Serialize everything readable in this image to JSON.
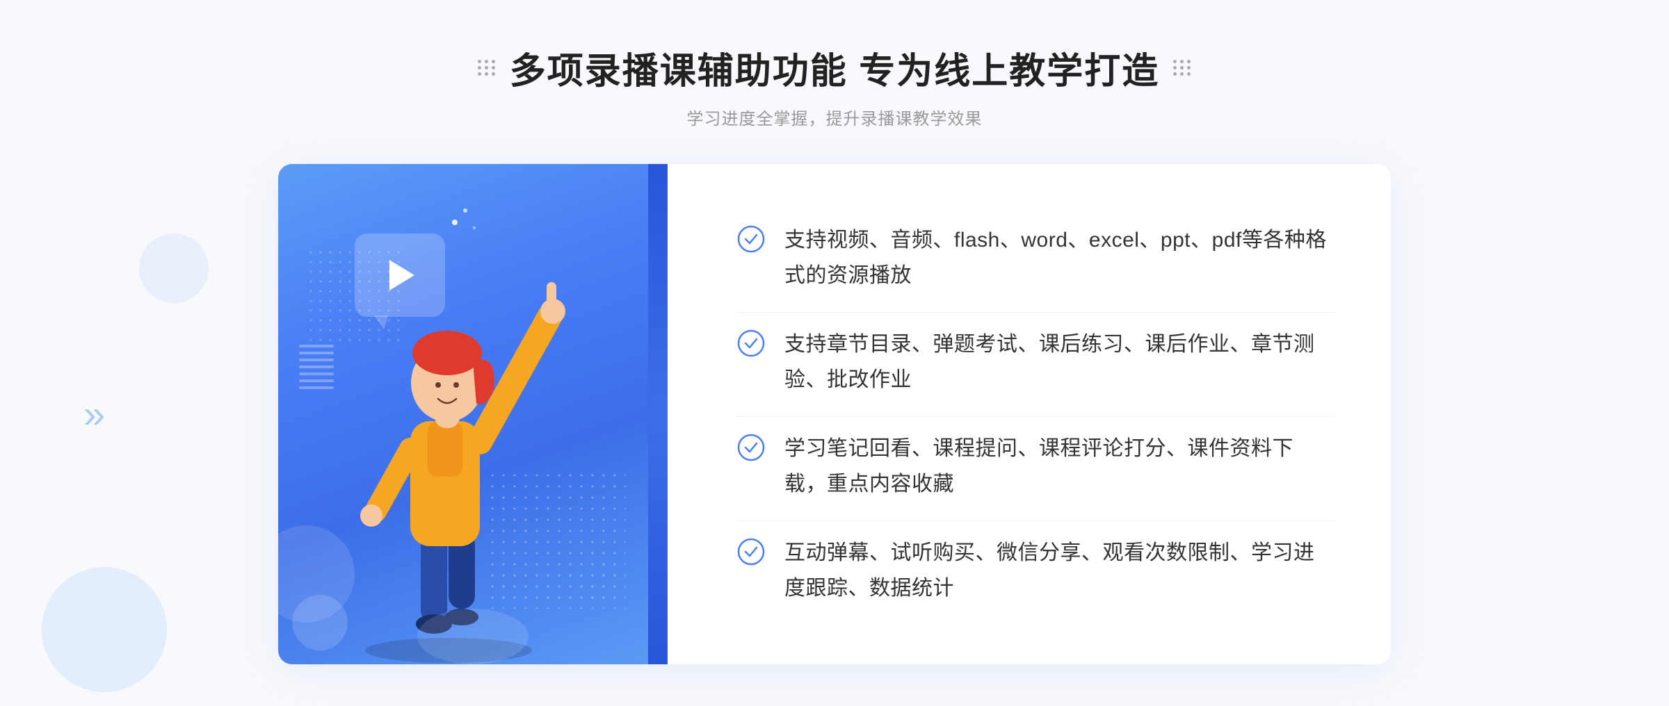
{
  "page": {
    "title": "多项录播课辅助功能 专为线上教学打造",
    "subtitle": "学习进度全掌握，提升录播课教学效果",
    "features": [
      {
        "id": "feature-1",
        "text": "支持视频、音频、flash、word、excel、ppt、pdf等各种格式的资源播放"
      },
      {
        "id": "feature-2",
        "text": "支持章节目录、弹题考试、课后练习、课后作业、章节测验、批改作业"
      },
      {
        "id": "feature-3",
        "text": "学习笔记回看、课程提问、课程评论打分、课件资料下载，重点内容收藏"
      },
      {
        "id": "feature-4",
        "text": "互动弹幕、试听购买、微信分享、观看次数限制、学习进度跟踪、数据统计"
      }
    ],
    "colors": {
      "primary": "#4a7ef5",
      "primary_dark": "#2955d8",
      "primary_light": "#5b9cf6",
      "text_main": "#222222",
      "text_sub": "#999999",
      "text_feature": "#333333",
      "check_color": "#4a7ef5",
      "divider": "#f0f2f8"
    },
    "decorative": {
      "chevron_left": "«",
      "chevron_left_outer": "»"
    }
  }
}
